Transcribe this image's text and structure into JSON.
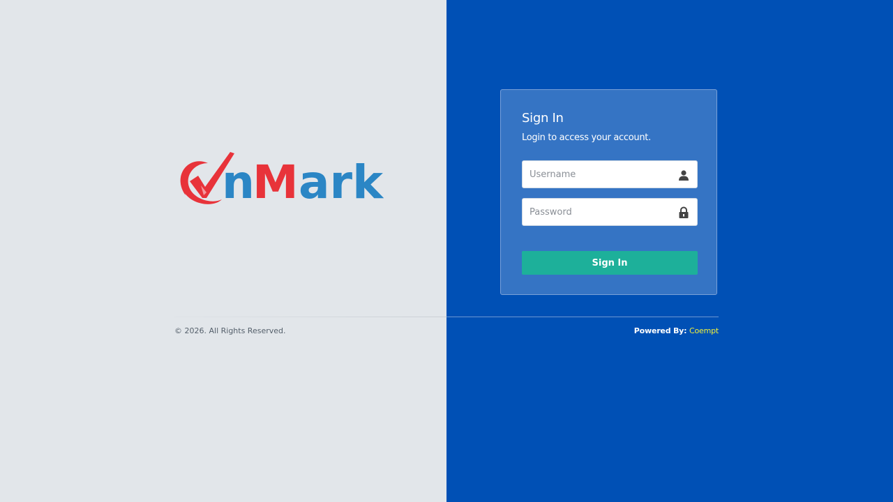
{
  "logo": {
    "text_prefix": "n",
    "text_m": "M",
    "text_suffix": "ark",
    "colors": {
      "red": "#e8333a",
      "blue": "#2b86c5"
    }
  },
  "login": {
    "title": "Sign In",
    "subtitle": "Login to access your account.",
    "username_placeholder": "Username",
    "password_placeholder": "Password",
    "submit_label": "Sign In",
    "icons": {
      "username": "user-icon",
      "password": "lock-icon"
    }
  },
  "footer": {
    "copyright": "© 2026. All Rights Reserved.",
    "powered_label": "Powered By:",
    "powered_link": "Coempt"
  },
  "colors": {
    "left_bg": "#e2e6ea",
    "right_bg": "#0050b5",
    "card_bg": "#3574c4",
    "button_bg": "#1db09a",
    "link_color": "#f2f23a"
  }
}
